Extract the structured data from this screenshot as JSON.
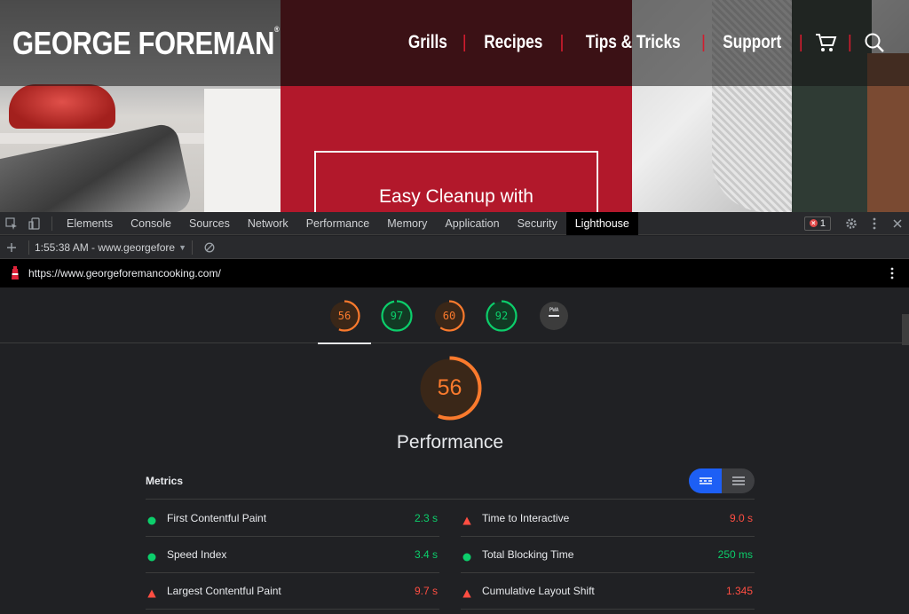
{
  "site": {
    "logo": "GEORGE FOREMAN",
    "logo_mark": "®",
    "nav": [
      "Grills",
      "Recipes",
      "Tips & Tricks",
      "Support"
    ],
    "hero_text": "Easy Cleanup with"
  },
  "devtools": {
    "tabs": [
      "Elements",
      "Console",
      "Sources",
      "Network",
      "Performance",
      "Memory",
      "Application",
      "Security",
      "Lighthouse"
    ],
    "active_tab": "Lighthouse",
    "error_count": "1",
    "report_label": "1:55:38 AM - www.georgefore",
    "url": "https://www.georgeforemancooking.com/"
  },
  "lighthouse": {
    "category_scores": [
      {
        "value": "56",
        "status": "average"
      },
      {
        "value": "97",
        "status": "pass"
      },
      {
        "value": "60",
        "status": "average"
      },
      {
        "value": "92",
        "status": "pass"
      },
      {
        "value": "PWA",
        "status": "na"
      }
    ],
    "performance_score": "56",
    "performance_title": "Performance",
    "metrics_title": "Metrics",
    "metrics_left": [
      {
        "name": "First Contentful Paint",
        "value": "2.3 s",
        "status": "pass"
      },
      {
        "name": "Speed Index",
        "value": "3.4 s",
        "status": "pass"
      },
      {
        "name": "Largest Contentful Paint",
        "value": "9.7 s",
        "status": "fail"
      }
    ],
    "metrics_right": [
      {
        "name": "Time to Interactive",
        "value": "9.0 s",
        "status": "fail"
      },
      {
        "name": "Total Blocking Time",
        "value": "250 ms",
        "status": "pass"
      },
      {
        "name": "Cumulative Layout Shift",
        "value": "1.345",
        "status": "fail"
      }
    ]
  },
  "colors": {
    "brand_red": "#b2182b",
    "score_average": "#fa7a2d",
    "score_pass": "#0cce6b",
    "score_fail": "#ff4e42",
    "toggle_active": "#1d5ff5"
  }
}
